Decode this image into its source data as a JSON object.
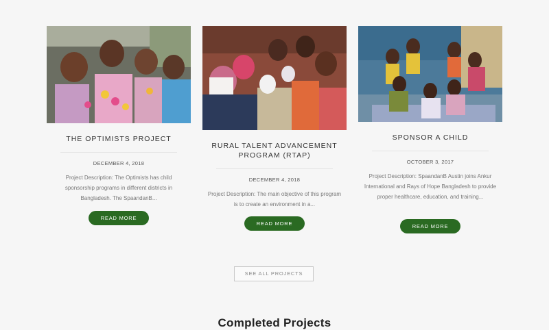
{
  "projects": [
    {
      "title": "THE OPTIMISTS PROJECT",
      "date": "DECEMBER 4, 2018",
      "description": "Project Description: The Optimists has child sponsorship programs in different districts in Bangladesh. The SpaandanB...",
      "button_label": "READ MORE",
      "image_icon": "children-group-photo"
    },
    {
      "title": "RURAL TALENT ADVANCEMENT PROGRAM (RTAP)",
      "date": "DECEMBER 4, 2018",
      "description": "Project Description: The main objective of this program is to create an environment in a...",
      "button_label": "READ MORE",
      "image_icon": "classroom-children-photo"
    },
    {
      "title": "SPONSOR A CHILD",
      "date": "OCTOBER 3, 2017",
      "description": "Project Description: SpaandanB Austin joins Ankur International and Rays of Hope Bangladesh to provide proper healthcare, education, and training...",
      "button_label": "READ MORE",
      "image_icon": "children-seated-photo"
    }
  ],
  "see_all_label": "SEE ALL PROJECTS",
  "completed_title": "Completed Projects",
  "colors": {
    "accent": "#2a6a22",
    "background": "#f6f6f6"
  }
}
